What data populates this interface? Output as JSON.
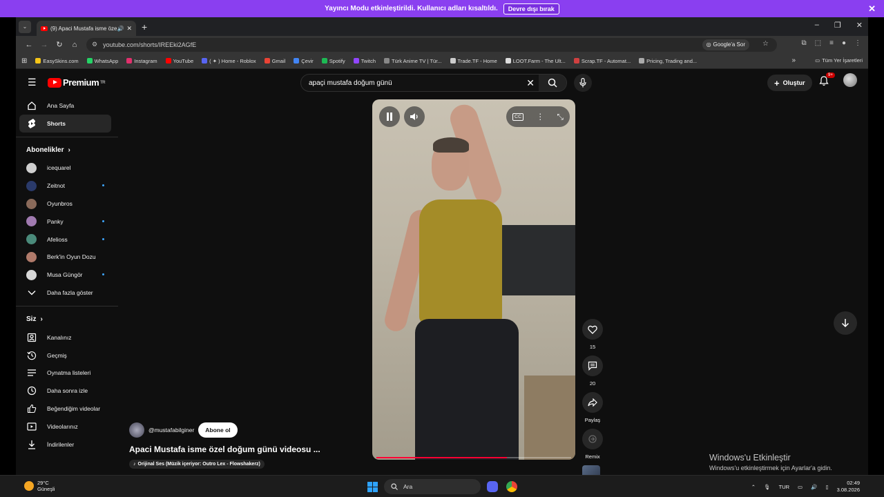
{
  "banner": {
    "text": "Yayıncı Modu etkinleştirildi. Kullanıcı adları kısaltıldı.",
    "button": "Devre dışı bırak"
  },
  "tab": {
    "title": "(9) Apaci Mustafa isme özel"
  },
  "address": {
    "url": "youtube.com/shorts/IREEki2AGfE",
    "google_button": "Google'a Sor"
  },
  "bookmarks": {
    "items": [
      {
        "label": "EasySkins.com",
        "color": "#f5c518"
      },
      {
        "label": "WhatsApp",
        "color": "#25d366"
      },
      {
        "label": "Instagram",
        "color": "#e1306c"
      },
      {
        "label": "YouTube",
        "color": "#ff0000"
      },
      {
        "label": "( ✦ ) Home - Roblox",
        "color": "#5865f2"
      },
      {
        "label": "Gmail",
        "color": "#ea4335"
      },
      {
        "label": "Çevir",
        "color": "#4285f4"
      },
      {
        "label": "Spotify",
        "color": "#1db954"
      },
      {
        "label": "Twitch",
        "color": "#9146ff"
      },
      {
        "label": "Türk Anime TV | Tür...",
        "color": "#888888"
      },
      {
        "label": "Trade.TF - Home",
        "color": "#cccccc"
      },
      {
        "label": "LOOT.Farm - The Ult...",
        "color": "#dddddd"
      },
      {
        "label": "Scrap.TF - Automat...",
        "color": "#d04040"
      },
      {
        "label": "Pricing, Trading and...",
        "color": "#aaaaaa"
      }
    ],
    "all": "Tüm Yer İşaretleri"
  },
  "youtube": {
    "logo": "Premium",
    "logo_sup": "TR",
    "search_value": "apaçi mustafa doğum günü",
    "create": "Oluştur",
    "notifications": "9+"
  },
  "sidebar": {
    "main": [
      {
        "label": "Ana Sayfa",
        "icon": "home-icon"
      },
      {
        "label": "Shorts",
        "icon": "shorts-icon"
      }
    ],
    "subs_heading": "Abonelikler",
    "subs": [
      {
        "label": "icequarel",
        "color": "#cfcfcf",
        "dot": false
      },
      {
        "label": "Zeitnot",
        "color": "#2a3a6a",
        "dot": true
      },
      {
        "label": "Oyunbros",
        "color": "#8a6a5a",
        "dot": false
      },
      {
        "label": "Panky",
        "color": "#a07ab0",
        "dot": true
      },
      {
        "label": "Afelioss",
        "color": "#4a8a7a",
        "dot": true
      },
      {
        "label": "Berk'in Oyun Dozu",
        "color": "#b07a6a",
        "dot": false
      },
      {
        "label": "Musa Güngör",
        "color": "#d8d8d8",
        "dot": true
      }
    ],
    "show_more": "Daha fazla göster",
    "you_heading": "Siz",
    "you": [
      {
        "label": "Kanalınız",
        "icon": "channel-icon"
      },
      {
        "label": "Geçmiş",
        "icon": "history-icon"
      },
      {
        "label": "Oynatma listeleri",
        "icon": "playlist-icon"
      },
      {
        "label": "Daha sonra izle",
        "icon": "clock-icon"
      },
      {
        "label": "Beğendiğim videolar",
        "icon": "thumbs-up-icon"
      },
      {
        "label": "Videolarınız",
        "icon": "videos-icon"
      },
      {
        "label": "İndirilenler",
        "icon": "download-icon"
      }
    ]
  },
  "short": {
    "channel": "@mustafabilginer",
    "subscribe": "Abone ol",
    "title": "Apaci Mustafa isme özel doğum günü videosu ...",
    "audio": "Orijinal Ses (Müzik içeriyor: Outro Lex - Flowshakerz)",
    "progress": 0.67
  },
  "actions": {
    "likes": "15",
    "comments": "20",
    "share": "Paylaş",
    "remix": "Remix"
  },
  "windows_activation": {
    "title": "Windows'u Etkinleştir",
    "body": "Windows'u etkinleştirmek için Ayarlar'a gidin."
  },
  "taskbar": {
    "temp": "29°C",
    "weather": "Güneşli",
    "search": "Ara",
    "lang": "TUR",
    "time": "02:49",
    "date": "3.08.2026"
  }
}
